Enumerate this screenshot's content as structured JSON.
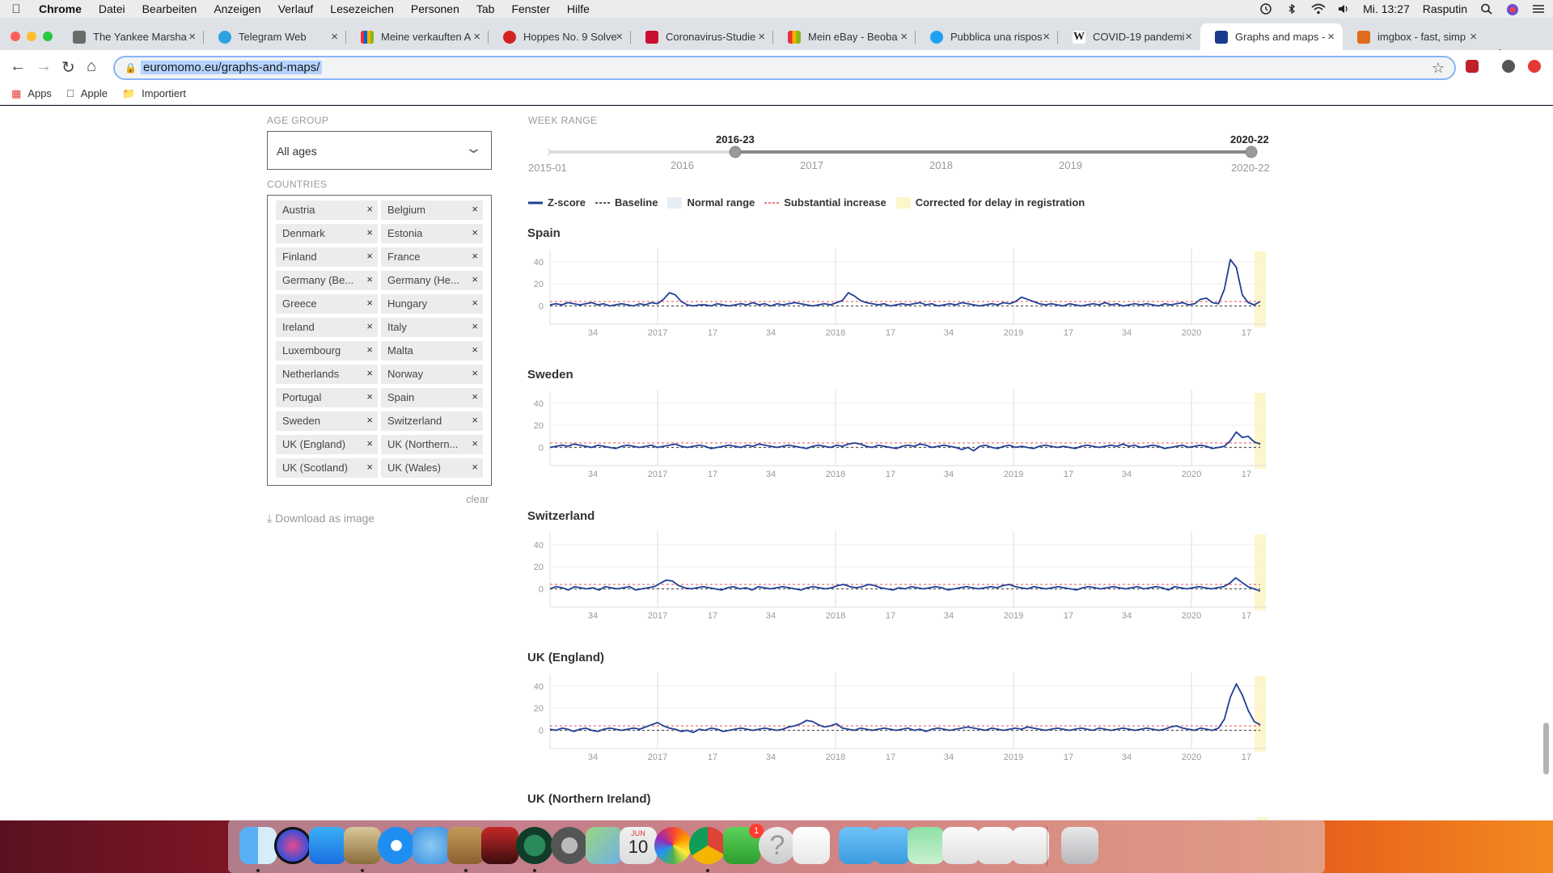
{
  "menubar": {
    "app": "Chrome",
    "items": [
      "Datei",
      "Bearbeiten",
      "Anzeigen",
      "Verlauf",
      "Lesezeichen",
      "Personen",
      "Tab",
      "Fenster",
      "Hilfe"
    ],
    "clock": "Mi. 13:27",
    "user": "Rasputin"
  },
  "tabs": [
    {
      "title": "The Yankee Marsha",
      "favicon": "page-icon",
      "color": "#6b6b6b"
    },
    {
      "title": "Telegram Web",
      "favicon": "telegram-icon",
      "color": "#2aa3e0"
    },
    {
      "title": "Meine verkauften A",
      "favicon": "ebay-icon",
      "color": "#e53238"
    },
    {
      "title": "Hoppes No. 9 Solve",
      "favicon": "yelp-icon",
      "color": "#d32323"
    },
    {
      "title": "Coronavirus-Studie",
      "favicon": "news-icon",
      "color": "#c8102e"
    },
    {
      "title": "Mein eBay - Beoba",
      "favicon": "bag-icon",
      "color": "#c44"
    },
    {
      "title": "Pubblica una rispos",
      "favicon": "chat-icon",
      "color": "#1da1f2"
    },
    {
      "title": "COVID-19 pandemi",
      "favicon": "wikipedia-icon",
      "color": "#222"
    },
    {
      "title": "Graphs and maps -",
      "favicon": "euromomo-icon",
      "color": "#1a3b8e"
    },
    {
      "title": "imgbox - fast, simp",
      "favicon": "imgbox-icon",
      "color": "#e06b1a"
    }
  ],
  "omnibox": {
    "url": "euromomo.eu/graphs-and-maps/"
  },
  "bookmarks": [
    {
      "label": "Apps",
      "icon": "apps-grid-icon"
    },
    {
      "label": "Apple",
      "icon": "apple-icon"
    },
    {
      "label": "Importiert",
      "icon": "folder-icon"
    }
  ],
  "filters": {
    "age_group_label": "AGE GROUP",
    "age_group_value": "All ages",
    "countries_label": "COUNTRIES",
    "countries": [
      "Austria",
      "Belgium",
      "Denmark",
      "Estonia",
      "Finland",
      "France",
      "Germany (Be...",
      "Germany (He...",
      "Greece",
      "Hungary",
      "Ireland",
      "Italy",
      "Luxembourg",
      "Malta",
      "Netherlands",
      "Norway",
      "Portugal",
      "Spain",
      "Sweden",
      "Switzerland",
      "UK (England)",
      "UK (Northern...",
      "UK (Scotland)",
      "UK (Wales)"
    ],
    "chip_remove": "×",
    "clear": "clear",
    "download": "Download as image"
  },
  "week_range": {
    "label": "WEEK RANGE",
    "min_label": "2015-01",
    "max_label": "2020-22",
    "selected_start": "2016-23",
    "selected_end": "2020-22",
    "years": [
      "2016",
      "2017",
      "2018",
      "2019"
    ]
  },
  "legend": {
    "zscore": "Z-score",
    "baseline": "Baseline",
    "normal_range": "Normal range",
    "substantial": "Substantial increase",
    "corrected": "Corrected for delay in registration"
  },
  "colors": {
    "zscore_line": "#1f3f95",
    "baseline": "#555555",
    "substantial": "#e05050",
    "normal_range": "#e8eef5",
    "corrected": "#fdf6cc"
  },
  "chart_data": [
    {
      "type": "line",
      "title": "Spain",
      "x_tick_labels": [
        "34",
        "2017",
        "17",
        "34",
        "2018",
        "17",
        "34",
        "2019",
        "17",
        "34",
        "2020",
        "17"
      ],
      "y_ticks": [
        0,
        20,
        40
      ],
      "ylim": [
        -15,
        45
      ],
      "series": [
        {
          "values": [
            1,
            2,
            1,
            3,
            2,
            1,
            2,
            3,
            1,
            2,
            0,
            1,
            2,
            1,
            0,
            2,
            1,
            3,
            2,
            6,
            12,
            10,
            4,
            1,
            0,
            1,
            1,
            0,
            2,
            1,
            0,
            1,
            2,
            1,
            3,
            1,
            2,
            0,
            2,
            1,
            2,
            3,
            2,
            1,
            0,
            1,
            2,
            1,
            3,
            5,
            12,
            9,
            5,
            3,
            2,
            1,
            2,
            0,
            1,
            2,
            1,
            2,
            3,
            1,
            2,
            0,
            1,
            2,
            1,
            3,
            2,
            1,
            0,
            1,
            2,
            1,
            3,
            2,
            4,
            8,
            6,
            4,
            2,
            1,
            2,
            1,
            0,
            2,
            1,
            0,
            1,
            2,
            1,
            3,
            1,
            2,
            0,
            1,
            2,
            1,
            2,
            1,
            0,
            2,
            1,
            2,
            3,
            1,
            2,
            6,
            7,
            3,
            2,
            15,
            42,
            35,
            10,
            3,
            1,
            4
          ]
        }
      ]
    },
    {
      "type": "line",
      "title": "Sweden",
      "x_tick_labels": [
        "34",
        "2017",
        "17",
        "34",
        "2018",
        "17",
        "34",
        "2019",
        "17",
        "34",
        "2020",
        "17"
      ],
      "y_ticks": [
        0,
        20,
        40
      ],
      "ylim": [
        -15,
        45
      ],
      "series": [
        {
          "values": [
            0,
            1,
            2,
            1,
            3,
            2,
            1,
            0,
            2,
            1,
            0,
            -1,
            1,
            2,
            1,
            0,
            1,
            2,
            0,
            1,
            2,
            3,
            1,
            0,
            1,
            2,
            1,
            -1,
            0,
            1,
            2,
            1,
            0,
            2,
            1,
            3,
            2,
            1,
            0,
            1,
            2,
            1,
            0,
            -1,
            1,
            2,
            1,
            0,
            2,
            1,
            3,
            4,
            3,
            1,
            0,
            2,
            1,
            0,
            -1,
            1,
            2,
            1,
            3,
            2,
            0,
            1,
            2,
            1,
            0,
            -2,
            0,
            -3,
            1,
            2,
            0,
            -1,
            1,
            2,
            0,
            1,
            0,
            -1,
            1,
            2,
            1,
            0,
            1,
            0,
            -1,
            1,
            2,
            1,
            0,
            1,
            2,
            1,
            3,
            1,
            2,
            0,
            1,
            2,
            1,
            -1,
            0,
            1,
            2,
            0,
            1,
            2,
            1,
            -1,
            0,
            1,
            6,
            14,
            9,
            10,
            5,
            3
          ]
        }
      ]
    },
    {
      "type": "line",
      "title": "Switzerland",
      "x_tick_labels": [
        "34",
        "2017",
        "17",
        "34",
        "2018",
        "17",
        "34",
        "2019",
        "17",
        "34",
        "2020",
        "17"
      ],
      "y_ticks": [
        0,
        20,
        40
      ],
      "ylim": [
        -15,
        45
      ],
      "series": [
        {
          "values": [
            0,
            2,
            1,
            -1,
            2,
            1,
            0,
            1,
            -1,
            2,
            1,
            0,
            1,
            2,
            -1,
            0,
            1,
            2,
            5,
            8,
            7,
            3,
            1,
            0,
            1,
            2,
            1,
            0,
            -1,
            1,
            2,
            0,
            1,
            -1,
            2,
            1,
            0,
            1,
            2,
            1,
            0,
            -1,
            1,
            2,
            1,
            0,
            1,
            3,
            4,
            2,
            1,
            2,
            4,
            3,
            1,
            0,
            -1,
            1,
            0,
            2,
            1,
            0,
            1,
            2,
            1,
            -1,
            0,
            1,
            2,
            1,
            0,
            1,
            2,
            1,
            3,
            4,
            2,
            1,
            0,
            2,
            1,
            0,
            1,
            2,
            1,
            0,
            -1,
            1,
            2,
            1,
            0,
            1,
            2,
            1,
            0,
            1,
            2,
            0,
            1,
            2,
            1,
            -1,
            2,
            1,
            0,
            1,
            2,
            1,
            0,
            1,
            2,
            5,
            10,
            6,
            2,
            0,
            -2
          ]
        }
      ]
    },
    {
      "type": "line",
      "title": "UK (England)",
      "x_tick_labels": [
        "34",
        "2017",
        "17",
        "34",
        "2018",
        "17",
        "34",
        "2019",
        "17",
        "34",
        "2020",
        "17"
      ],
      "y_ticks": [
        0,
        20,
        40
      ],
      "ylim": [
        -15,
        45
      ],
      "series": [
        {
          "values": [
            1,
            0,
            2,
            1,
            -1,
            1,
            2,
            0,
            -1,
            1,
            2,
            1,
            0,
            1,
            2,
            1,
            3,
            5,
            7,
            4,
            2,
            1,
            -1,
            0,
            -2,
            1,
            0,
            2,
            1,
            -1,
            0,
            1,
            2,
            1,
            0,
            1,
            2,
            1,
            0,
            1,
            3,
            4,
            6,
            9,
            8,
            5,
            3,
            4,
            6,
            2,
            1,
            0,
            2,
            1,
            0,
            1,
            2,
            1,
            0,
            1,
            2,
            0,
            1,
            -1,
            1,
            2,
            1,
            0,
            1,
            2,
            3,
            2,
            1,
            0,
            2,
            1,
            0,
            1,
            2,
            1,
            3,
            2,
            1,
            0,
            1,
            2,
            1,
            0,
            1,
            2,
            1,
            0,
            2,
            1,
            0,
            1,
            2,
            1,
            0,
            1,
            2,
            1,
            0,
            1,
            3,
            4,
            2,
            1,
            0,
            2,
            1,
            0,
            2,
            10,
            30,
            42,
            32,
            18,
            8,
            5
          ]
        }
      ]
    },
    {
      "type": "line",
      "title": "UK (Northern Ireland)",
      "series": []
    }
  ],
  "dock": {
    "apps": [
      "finder-icon",
      "siri-icon",
      "app-store-icon",
      "preview-icon",
      "safari-icon",
      "messages-icon",
      "notes-icon",
      "photo-booth-icon",
      "time-machine-icon",
      "system-preferences-icon",
      "maps-icon",
      "calendar-icon",
      "photos-icon",
      "chrome-icon",
      "facetime-icon",
      "help-icon",
      "reminders-icon",
      "folder-icon",
      "applications-folder-icon",
      "screenshot-icon",
      "document-icon",
      "document-icon",
      "document-icon",
      "trash-icon"
    ],
    "calendar_day": "10",
    "calendar_month": "JUN",
    "facetime_badge": "1"
  }
}
